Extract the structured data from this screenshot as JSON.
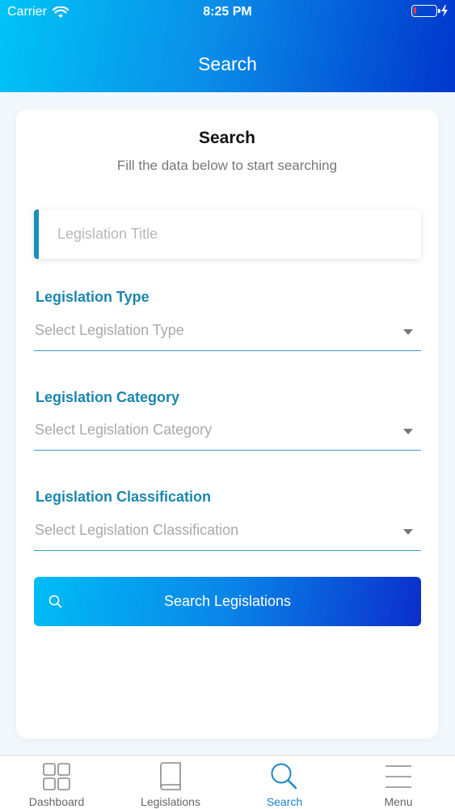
{
  "status_bar": {
    "carrier": "Carrier",
    "time": "8:25 PM",
    "battery_level_percent": 5
  },
  "header": {
    "title": "Search"
  },
  "card": {
    "title": "Search",
    "subtitle": "Fill the data below to start searching"
  },
  "form": {
    "legislation_title": {
      "placeholder": "Legislation Title",
      "value": ""
    },
    "legislation_type": {
      "label": "Legislation Type",
      "placeholder": "Select Legislation Type"
    },
    "legislation_category": {
      "label": "Legislation Category",
      "placeholder": "Select Legislation Category"
    },
    "legislation_classification": {
      "label": "Legislation Classification",
      "placeholder": "Select Legislation Classification"
    },
    "search_button": {
      "label": "Search Legislations",
      "icon": "search-icon"
    }
  },
  "tabbar": {
    "tabs": [
      {
        "label": "Dashboard",
        "icon": "grid-icon",
        "active": false
      },
      {
        "label": "Legislations",
        "icon": "book-icon",
        "active": false
      },
      {
        "label": "Search",
        "icon": "search-icon",
        "active": true
      },
      {
        "label": "Menu",
        "icon": "hamburger-icon",
        "active": false
      }
    ]
  },
  "colors": {
    "header_gradient_start": "#00c4f6",
    "header_gradient_end": "#0036cc",
    "label_blue": "#1b86ad",
    "active_tab": "#1d84c6"
  }
}
